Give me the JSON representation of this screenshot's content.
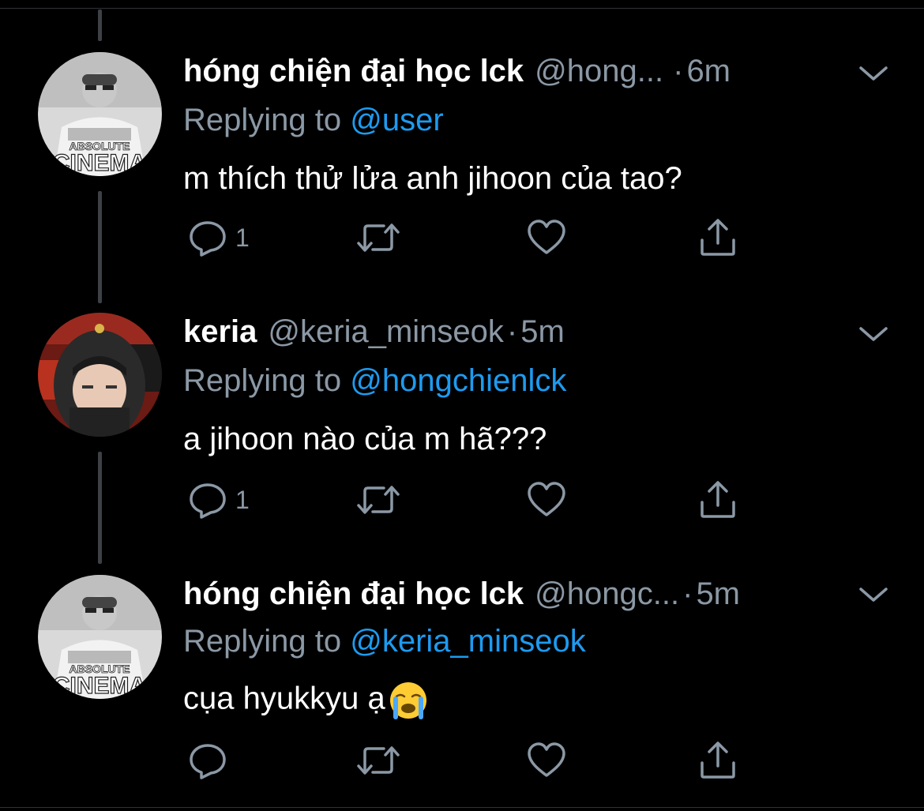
{
  "tweets": [
    {
      "name": "hóng chiện đại học lck",
      "handle": "@hong...",
      "separator": "·",
      "time": "6m",
      "replying_prefix": "Replying to ",
      "replying_to": "@user",
      "text": "m thích thử lửa anh jihoon của tao?",
      "reply_count": "1",
      "avatar_caption_top": "ABSOLUTE",
      "avatar_caption_bottom": "CINEMA"
    },
    {
      "name": "keria",
      "handle": "@keria_minseok",
      "separator": "·",
      "time": "5m",
      "replying_prefix": "Replying to ",
      "replying_to": "@hongchienlck",
      "text": "a jihoon nào của m hã???",
      "reply_count": "1"
    },
    {
      "name": "hóng chiện đại học lck",
      "handle": "@hongc...",
      "separator": "·",
      "time": "5m",
      "replying_prefix": "Replying to ",
      "replying_to": "@keria_minseok",
      "text": "cụa hyukkyu ạ",
      "emoji": "loudly-crying-face",
      "reply_count": "",
      "avatar_caption_top": "ABSOLUTE",
      "avatar_caption_bottom": "CINEMA"
    }
  ],
  "icons": {
    "reply": "reply-icon",
    "retweet": "retweet-icon",
    "like": "heart-icon",
    "share": "share-icon",
    "more": "chevron-down-icon"
  },
  "colors": {
    "background": "#000000",
    "text_primary": "#ffffff",
    "text_secondary": "#8b98a5",
    "link": "#1d9bf0",
    "divider": "#2f3336"
  }
}
